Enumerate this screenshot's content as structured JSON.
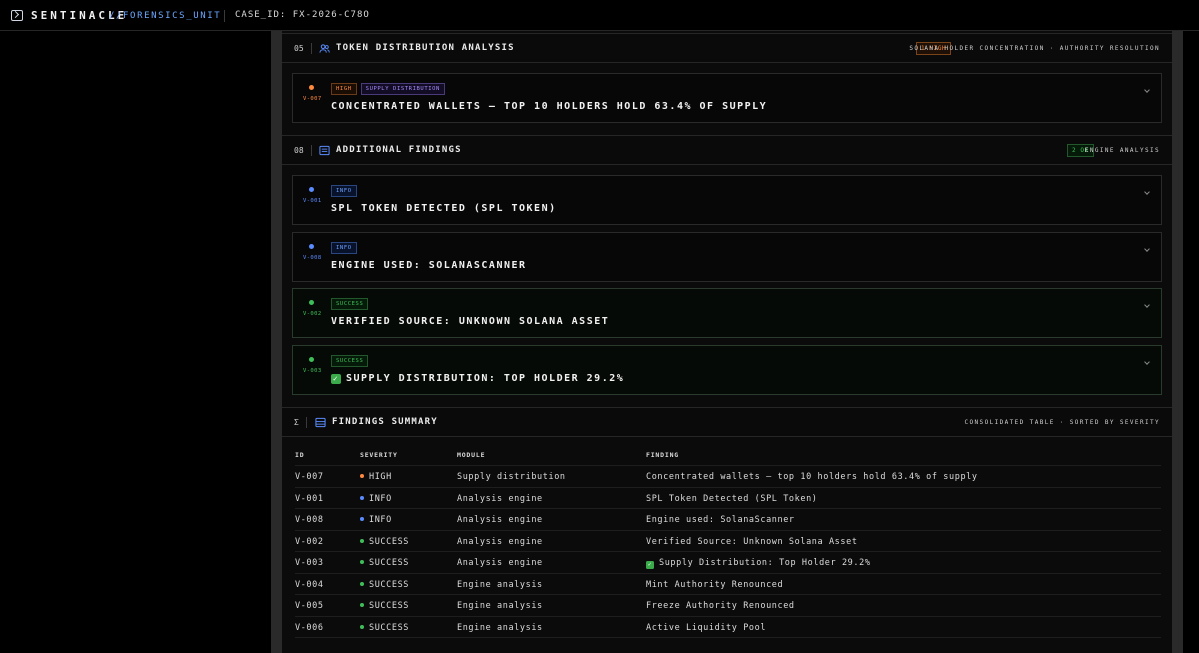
{
  "topbar": {
    "brand": "SENTINACLE",
    "unit": "//FORENSICS_UNIT",
    "case_id": "CASE_ID: FX-2026-C78O"
  },
  "colors": {
    "high": "#ff8a3d",
    "info": "#5b8cff",
    "success": "#3fbf5a",
    "purple": "#a78bfa"
  },
  "sections": {
    "token_distribution": {
      "num": "05",
      "icon": "users-icon",
      "title": "TOKEN DISTRIBUTION ANALYSIS",
      "badge": "1 HIGH",
      "meta": "SOLANA HOLDER CONCENTRATION · AUTHORITY RESOLUTION"
    },
    "additional": {
      "num": "08",
      "icon": "list-icon",
      "title": "ADDITIONAL FINDINGS",
      "badge": "2 OK",
      "meta": "ENGINE ANALYSIS"
    },
    "summary": {
      "num": "Σ",
      "icon": "table-icon",
      "title": "FINDINGS SUMMARY",
      "meta": "CONSOLIDATED TABLE · SORTED BY SEVERITY"
    }
  },
  "cards": [
    {
      "id": "V-007",
      "severity": "HIGH",
      "category": "SUPPLY DISTRIBUTION",
      "title": "CONCENTRATED WALLETS — TOP 10 HOLDERS HOLD 63.4% OF SUPPLY"
    },
    {
      "id": "V-001",
      "severity": "INFO",
      "title": "SPL TOKEN DETECTED (SPL TOKEN)"
    },
    {
      "id": "V-008",
      "severity": "INFO",
      "title": "ENGINE USED: SOLANASCANNER"
    },
    {
      "id": "V-002",
      "severity": "SUCCESS",
      "title": "VERIFIED SOURCE: UNKNOWN SOLANA ASSET"
    },
    {
      "id": "V-003",
      "severity": "SUCCESS",
      "title": "SUPPLY DISTRIBUTION: TOP HOLDER 29.2%"
    }
  ],
  "table": {
    "headers": {
      "id": "ID",
      "severity": "SEVERITY",
      "module": "MODULE",
      "finding": "FINDING"
    },
    "rows": [
      {
        "id": "V-007",
        "severity": "HIGH",
        "module": "Supply distribution",
        "finding": "Concentrated wallets — top 10 holders hold 63.4% of supply"
      },
      {
        "id": "V-001",
        "severity": "INFO",
        "module": "Analysis engine",
        "finding": "SPL Token Detected (SPL Token)"
      },
      {
        "id": "V-008",
        "severity": "INFO",
        "module": "Analysis engine",
        "finding": "Engine used: SolanaScanner"
      },
      {
        "id": "V-002",
        "severity": "SUCCESS",
        "module": "Analysis engine",
        "finding": "Verified Source: Unknown Solana Asset"
      },
      {
        "id": "V-003",
        "severity": "SUCCESS",
        "module": "Analysis engine",
        "finding": "Supply Distribution: Top Holder 29.2%"
      },
      {
        "id": "V-004",
        "severity": "SUCCESS",
        "module": "Engine analysis",
        "finding": "Mint Authority Renounced"
      },
      {
        "id": "V-005",
        "severity": "SUCCESS",
        "module": "Engine analysis",
        "finding": "Freeze Authority Renounced"
      },
      {
        "id": "V-006",
        "severity": "SUCCESS",
        "module": "Engine analysis",
        "finding": "Active Liquidity Pool"
      }
    ]
  }
}
